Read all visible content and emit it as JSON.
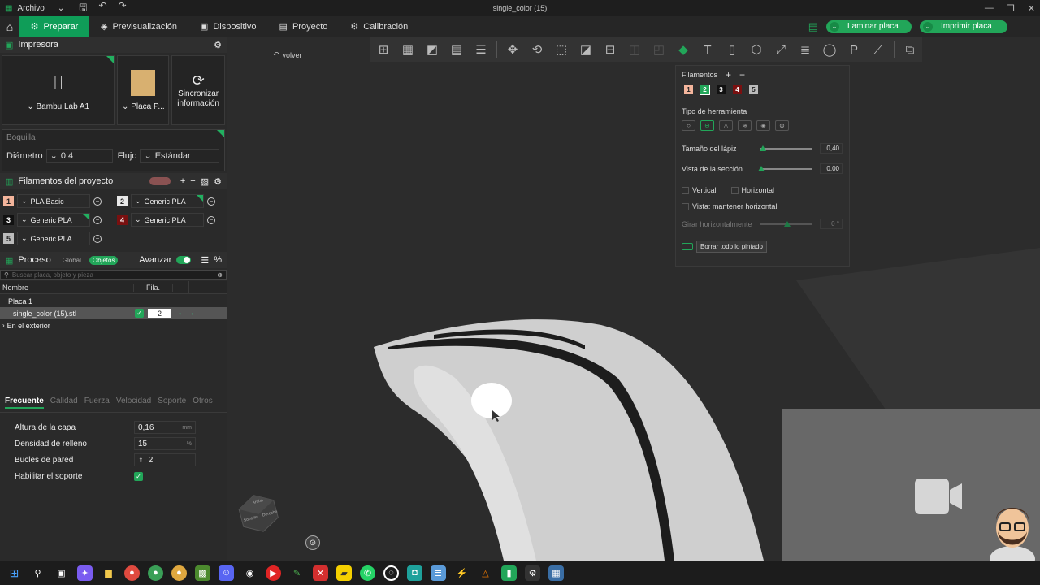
{
  "titlebar": {
    "menu_label": "Archivo",
    "title": "single_color (15)",
    "min": "—",
    "max": "❐",
    "close": "✕"
  },
  "nav": {
    "tabs": [
      {
        "label": "Preparar",
        "icon": "⚙"
      },
      {
        "label": "Previsualización",
        "icon": "◈"
      },
      {
        "label": "Dispositivo",
        "icon": "▣"
      },
      {
        "label": "Proyecto",
        "icon": "▤"
      },
      {
        "label": "Calibración",
        "icon": "⚙"
      }
    ],
    "slice_label": "Laminar placa",
    "print_label": "Imprimir placa"
  },
  "printer": {
    "section_title": "Impresora",
    "printer_name": "Bambu Lab A1",
    "plate_name": "Placa P...",
    "sync_label": "Sincronizar información"
  },
  "nozzle": {
    "title": "Boquilla",
    "diameter_label": "Diámetro",
    "diameter_value": "0.4",
    "flow_label": "Flujo",
    "flow_value": "Estándar"
  },
  "filaments": {
    "section_title": "Filamentos del proyecto",
    "items": [
      {
        "num": "1",
        "name": "PLA Basic",
        "color": "#f4b59c",
        "text": "#222"
      },
      {
        "num": "2",
        "name": "Generic PLA",
        "color": "#e8e8e8",
        "text": "#222"
      },
      {
        "num": "3",
        "name": "Generic PLA",
        "color": "#111111",
        "text": "#fff"
      },
      {
        "num": "4",
        "name": "Generic PLA",
        "color": "#7a1010",
        "text": "#fff"
      },
      {
        "num": "5",
        "name": "Generic PLA",
        "color": "#bbbbbb",
        "text": "#222"
      }
    ]
  },
  "process": {
    "section_title": "Proceso",
    "global_label": "Global",
    "objects_label": "Objetos",
    "advance_label": "Avanzar",
    "search_placeholder": "Buscar placa, objeto y pieza",
    "col_name": "Nombre",
    "col_fil": "Fila.",
    "plate_label": "Placa 1",
    "object_name": "single_color (15).stl",
    "object_fil": "2",
    "outside_label": "En el exterior"
  },
  "settings_tabs": [
    "Frecuente",
    "Calidad",
    "Fuerza",
    "Velocidad",
    "Soporte",
    "Otros"
  ],
  "params": {
    "layer_height": {
      "label": "Altura de la capa",
      "value": "0,16",
      "unit": "mm"
    },
    "infill": {
      "label": "Densidad de relleno",
      "value": "15",
      "unit": "%"
    },
    "walls": {
      "label": "Bucles de pared",
      "value": "2"
    },
    "support": {
      "label": "Habilitar el soporte"
    }
  },
  "viewport": {
    "back_label": "volver"
  },
  "paint": {
    "filaments_label": "Filamentos",
    "tool_type_label": "Tipo de herramienta",
    "pen_size_label": "Tamaño del lápiz",
    "pen_size_value": "0,40",
    "section_view_label": "Vista de la sección",
    "section_view_value": "0,00",
    "vertical_label": "Vertical",
    "horizontal_label": "Horizontal",
    "keep_horizontal_label": "Vista: mantener horizontal",
    "rotate_label": "Girar horizontalmente",
    "rotate_value": "0 °",
    "clear_label": "Borrar todo lo pintado"
  },
  "gizmo": {
    "a": "Arriba",
    "b": "Soporte",
    "c": "Derecho"
  }
}
